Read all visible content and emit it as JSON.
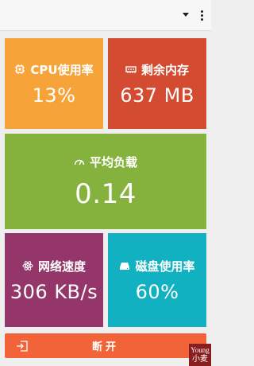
{
  "colors": {
    "cpu": "#f6a43a",
    "memory": "#d34b30",
    "load": "#85b13d",
    "network": "#943669",
    "disk": "#12b1c2",
    "disconnect": "#f2633a"
  },
  "topbar": {
    "dropdown_icon": "caret-down-icon",
    "menu_icon": "more-vert-icon"
  },
  "tiles": {
    "cpu": {
      "icon": "cpu-chip-icon",
      "label": "CPU使用率",
      "value": "13%"
    },
    "memory": {
      "icon": "memory-icon",
      "label": "剩余内存",
      "value": "637 MB"
    },
    "load": {
      "icon": "gauge-icon",
      "label": "平均负载",
      "value": "0.14"
    },
    "network": {
      "icon": "atom-icon",
      "label": "网络速度",
      "value": "306 KB/s"
    },
    "disk": {
      "icon": "disk-icon",
      "label": "磁盘使用率",
      "value": "60%"
    }
  },
  "disconnect": {
    "icon": "exit-icon",
    "label": "断开"
  },
  "watermark": {
    "line1": "Young",
    "line2": "小麦"
  }
}
